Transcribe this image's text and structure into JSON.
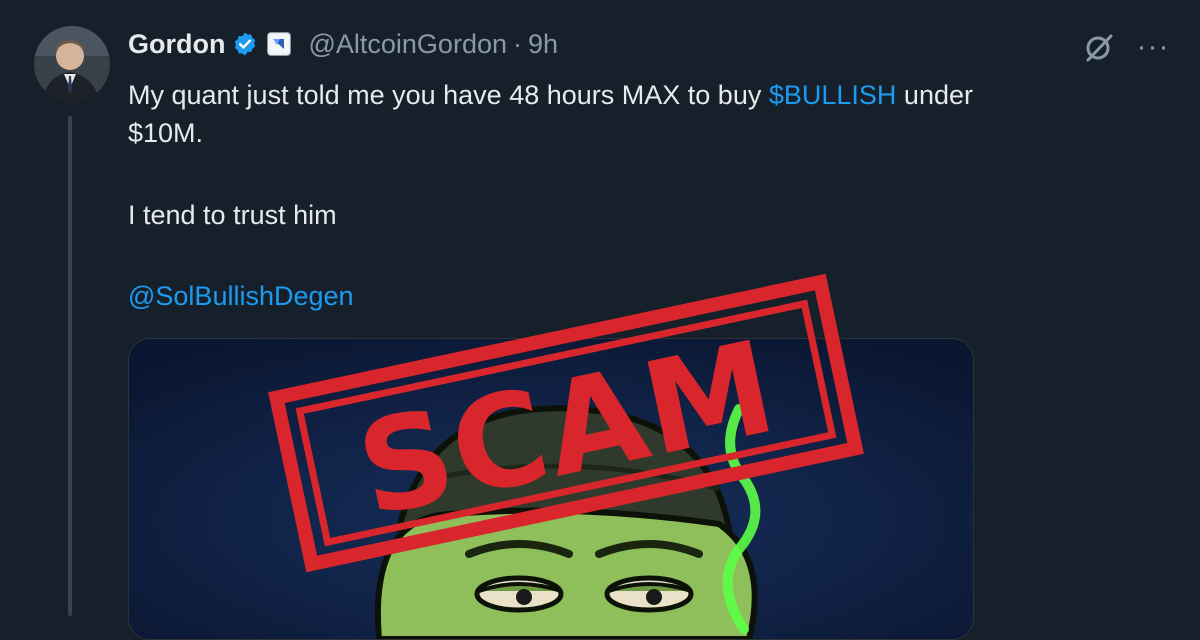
{
  "tweet": {
    "author_name": "Gordon",
    "handle": "@AltcoinGordon",
    "separator": "·",
    "timestamp": "9h",
    "line1_prefix": "My quant just told me you have 48 hours MAX to buy ",
    "cashtag": "$BULLISH",
    "line1_suffix": " under",
    "line2": "$10M.",
    "line3": "I tend to trust him",
    "mention": "@SolBullishDegen"
  },
  "more_label": "···",
  "stamp_text": "SCAM",
  "colors": {
    "background": "#15202b",
    "link": "#1d9bf0",
    "secondary_text": "#8b98a5",
    "stamp_red": "#d8262c",
    "media_bg": "#0d1b3d",
    "character_green": "#7aa24a"
  },
  "icons": [
    "verified-badge-icon",
    "affiliate-badge-icon",
    "grok-icon",
    "more-icon"
  ]
}
